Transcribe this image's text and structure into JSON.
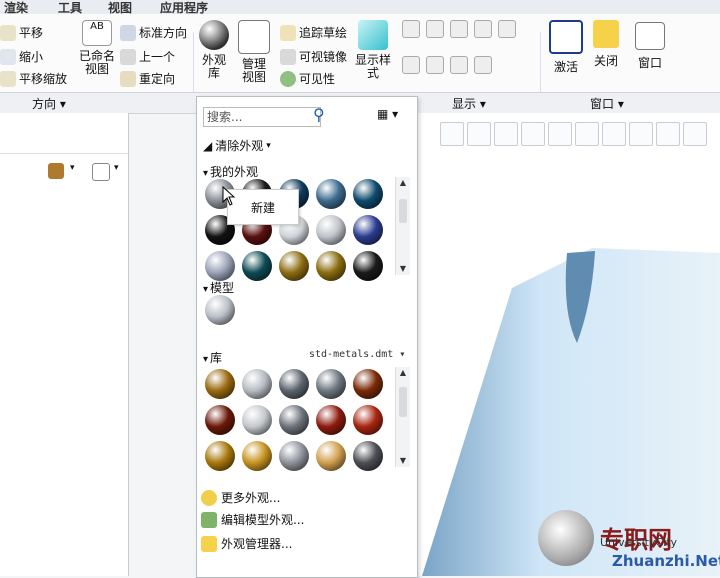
{
  "menubar": {
    "items": [
      "渲染",
      "工具",
      "视图",
      "应用程序"
    ]
  },
  "ribbon": {
    "orient": {
      "pan": "平移",
      "zoom_out": "缩小",
      "pan_zoom": "平移缩放",
      "saved_views": "已命名\n视图",
      "std_orient": "标准方向",
      "previous": "上一个",
      "reorient": "重定向"
    },
    "display": {
      "appearance_lib": "外观库",
      "manage_views": "管理视图",
      "display_style": "显示样式",
      "trace_sketch": "追踪草绘",
      "visible_mirror": "可视镜像",
      "visibility": "可见性"
    },
    "window": {
      "activate": "激活",
      "close": "关闭",
      "window": "窗口"
    }
  },
  "groupbar": {
    "orientation": "方向 ▾",
    "display": "显示 ▾",
    "window": "窗口 ▾"
  },
  "panel": {
    "search_placeholder": "搜索...",
    "clear_appearance": "清除外观",
    "my_appearances": "我的外观",
    "tooltip": "新建",
    "model": "模型",
    "library": "库",
    "library_file": "std-metals.dmt",
    "more": "更多外观...",
    "edit_model": "编辑模型外观...",
    "manager": "外观管理器...",
    "my_swatches": [
      "#8a8f98",
      "#1a1a1a",
      "#0e3b5c",
      "#3d6c8e",
      "#0f4a6e",
      "#111111",
      "#5a1010",
      "#cfd3d8",
      "#bfc3c8",
      "#2b3d8f",
      "#9aa3b8",
      "#0d4a52",
      "#8c6d12",
      "#8a6d10",
      "#1a1a1a"
    ],
    "model_swatches": [
      "#b9c0c8"
    ],
    "lib_swatches": [
      "#9a6a10",
      "#b7bcc2",
      "#5d6570",
      "#6f7882",
      "#7a2a08",
      "#6b1808",
      "#c4c8cc",
      "#6d737b",
      "#8e1b0f",
      "#a82510",
      "#a8780c",
      "#c79422",
      "#8e939a",
      "#d2a050",
      "#4c4f55"
    ]
  },
  "brand": {
    "cn": "专职网",
    "url": "Zhuanzhi.Net",
    "sub": "UniversityCity"
  },
  "colors": {
    "accent": "#1e5aa8",
    "model": "#b8d4ec"
  }
}
